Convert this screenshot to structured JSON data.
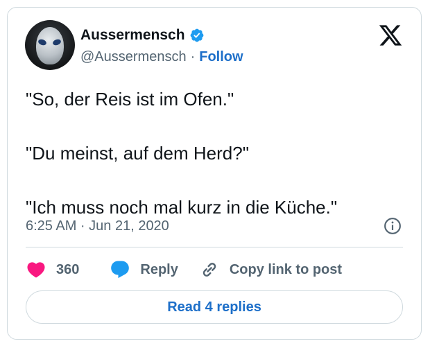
{
  "author": {
    "name": "Aussermensch",
    "handle": "@Aussermensch",
    "separator": "·",
    "follow_label": "Follow"
  },
  "tweet": {
    "lines": [
      "\"So, der Reis ist im Ofen.\"",
      "\"Du meinst, auf dem Herd?\"",
      "\"Ich muss noch mal kurz in die Küche.\""
    ],
    "timestamp": "6:25 AM · Jun 21, 2020"
  },
  "actions": {
    "like_count": "360",
    "reply_label": "Reply",
    "copy_label": "Copy link to post"
  },
  "footer": {
    "read_replies_label": "Read 4 replies"
  },
  "colors": {
    "accent": "#1d6fc9",
    "like": "#f91880",
    "verified": "#1d9bf0",
    "text": "#0f1419",
    "muted": "#536471",
    "border": "#cfd9de"
  },
  "icons": [
    "verified-badge-icon",
    "x-logo-icon",
    "info-icon",
    "heart-icon",
    "reply-bubble-icon",
    "link-icon"
  ]
}
